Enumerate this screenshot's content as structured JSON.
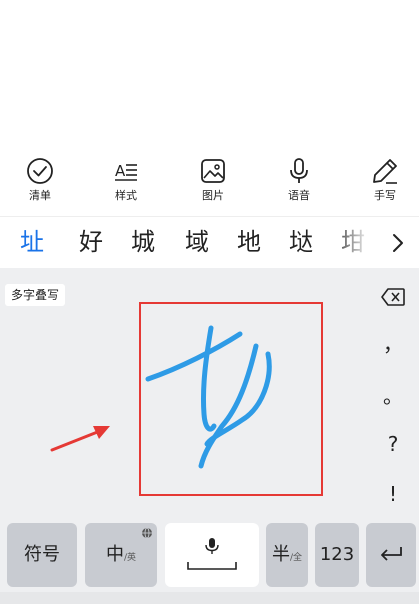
{
  "toolbar": {
    "items": [
      {
        "label": "清单",
        "icon": "checklist-icon"
      },
      {
        "label": "样式",
        "icon": "text-style-icon"
      },
      {
        "label": "图片",
        "icon": "image-icon"
      },
      {
        "label": "语音",
        "icon": "microphone-icon"
      },
      {
        "label": "手写",
        "icon": "pen-icon"
      }
    ]
  },
  "candidates": {
    "items": [
      "址",
      "好",
      "城",
      "域",
      "地",
      "垯",
      "坩"
    ],
    "active_index": 0,
    "more_icon": "chevron-right-icon"
  },
  "handwriting": {
    "mode_label": "多字叠写",
    "side_keys": [
      "，",
      "。",
      "?",
      "!"
    ],
    "backspace_icon": "backspace-icon",
    "stroke_color": "#2e9be6",
    "highlight_color": "#e53935"
  },
  "keys": {
    "symbols": "符号",
    "chinese": "中",
    "chinese_sub": "/英",
    "half": "半",
    "half_sub": "/全",
    "numbers": "123",
    "space_icon": "microphone-icon",
    "enter_icon": "enter-icon",
    "globe_icon": "globe-icon"
  },
  "colors": {
    "active_candidate": "#1a73e8",
    "panel_bg": "#eeeff1",
    "key_bg": "#c8cbd1"
  }
}
